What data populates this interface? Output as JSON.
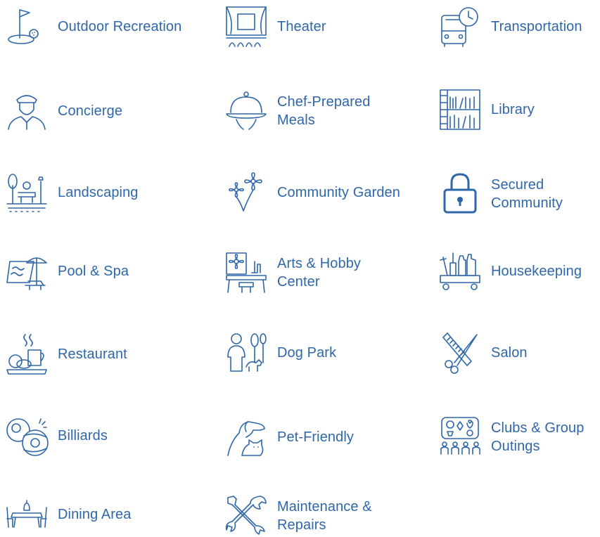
{
  "accent_color": "#2f67a8",
  "amenities": [
    {
      "label": "Outdoor Recreation",
      "icon": "golf-flag-icon"
    },
    {
      "label": "Theater",
      "icon": "theater-stage-icon"
    },
    {
      "label": "Transportation",
      "icon": "bus-clock-icon"
    },
    {
      "label": "Concierge",
      "icon": "concierge-person-icon"
    },
    {
      "label": "Chef-Prepared Meals",
      "icon": "cloche-icon"
    },
    {
      "label": "Library",
      "icon": "bookshelf-icon"
    },
    {
      "label": "Landscaping",
      "icon": "park-bench-icon"
    },
    {
      "label": "Community Garden",
      "icon": "flowers-icon"
    },
    {
      "label": "Secured Community",
      "icon": "padlock-icon"
    },
    {
      "label": "Pool & Spa",
      "icon": "pool-umbrella-icon"
    },
    {
      "label": "Arts & Hobby Center",
      "icon": "easel-icon"
    },
    {
      "label": "Housekeeping",
      "icon": "cleaning-cart-icon"
    },
    {
      "label": "Restaurant",
      "icon": "food-plate-icon"
    },
    {
      "label": "Dog Park",
      "icon": "dog-walker-icon"
    },
    {
      "label": "Salon",
      "icon": "scissors-comb-icon"
    },
    {
      "label": "Billiards",
      "icon": "billiard-balls-icon"
    },
    {
      "label": "Pet-Friendly",
      "icon": "dog-cat-icon"
    },
    {
      "label": "Clubs & Group Outings",
      "icon": "game-board-icon"
    },
    {
      "label": "Dining Area",
      "icon": "dining-table-icon"
    },
    {
      "label": "Maintenance & Repairs",
      "icon": "wrench-screwdriver-icon"
    }
  ]
}
